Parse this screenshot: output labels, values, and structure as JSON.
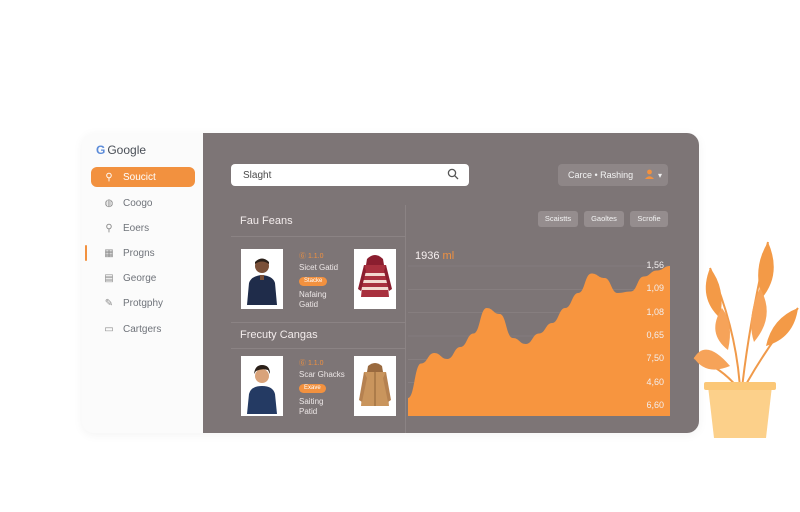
{
  "brand": {
    "letter": "G",
    "name": "Google"
  },
  "sidebar": {
    "items": [
      {
        "label": "Soucict",
        "icon": "search-icon",
        "glyph": "⚲"
      },
      {
        "label": "Coogo",
        "icon": "globe-icon",
        "glyph": "◍"
      },
      {
        "label": "Eoers",
        "icon": "magnifier-icon",
        "glyph": "⚲"
      },
      {
        "label": "Progns",
        "icon": "calendar-icon",
        "glyph": "▦"
      },
      {
        "label": "George",
        "icon": "document-icon",
        "glyph": "▤"
      },
      {
        "label": "Protgphy",
        "icon": "pencil-icon",
        "glyph": "✎"
      },
      {
        "label": "Cartgers",
        "icon": "chat-icon",
        "glyph": "▭"
      }
    ]
  },
  "search": {
    "value": "Slaght",
    "icon": "search-icon"
  },
  "top_dropdown": {
    "label": "Carce • Rashing",
    "icon": "avatar-icon",
    "caret": "▾"
  },
  "sections": {
    "first_title": "Fau Feans",
    "second_title": "Frecuty Cangas"
  },
  "products": [
    {
      "tag": "Ⓖ 1.1.0",
      "title": "Sicet Gatid",
      "pill": "Stacke",
      "line2": "Nafaing",
      "line3": "Gatid"
    },
    {
      "tag": "Ⓖ 1.1.0",
      "title": "Scar Ghacks",
      "pill": "Exave",
      "line2": "Saiting",
      "line3": "Patid"
    }
  ],
  "filters": [
    "Scaistts",
    "Gaoltes",
    "Scrofie"
  ],
  "chart_data": {
    "type": "area",
    "title": "1936",
    "title_unit": "ml",
    "y_tick_labels": [
      "1,56",
      "1,09",
      "1,08",
      "0,65",
      "7,50",
      "4,60",
      "6,60"
    ],
    "x": [
      0,
      0.05,
      0.1,
      0.15,
      0.2,
      0.25,
      0.3,
      0.35,
      0.4,
      0.45,
      0.5,
      0.55,
      0.6,
      0.65,
      0.7,
      0.75,
      0.8,
      0.85,
      0.9,
      0.95,
      1.0
    ],
    "values": [
      0.12,
      0.35,
      0.42,
      0.38,
      0.46,
      0.55,
      0.72,
      0.68,
      0.52,
      0.48,
      0.55,
      0.62,
      0.72,
      0.82,
      0.95,
      0.92,
      0.82,
      0.83,
      0.93,
      0.97,
      1.0
    ],
    "fill": "#f7953f"
  },
  "colors": {
    "accent": "#f2913f",
    "panel": "#7d7576",
    "sidebar": "#fbfbfb"
  }
}
